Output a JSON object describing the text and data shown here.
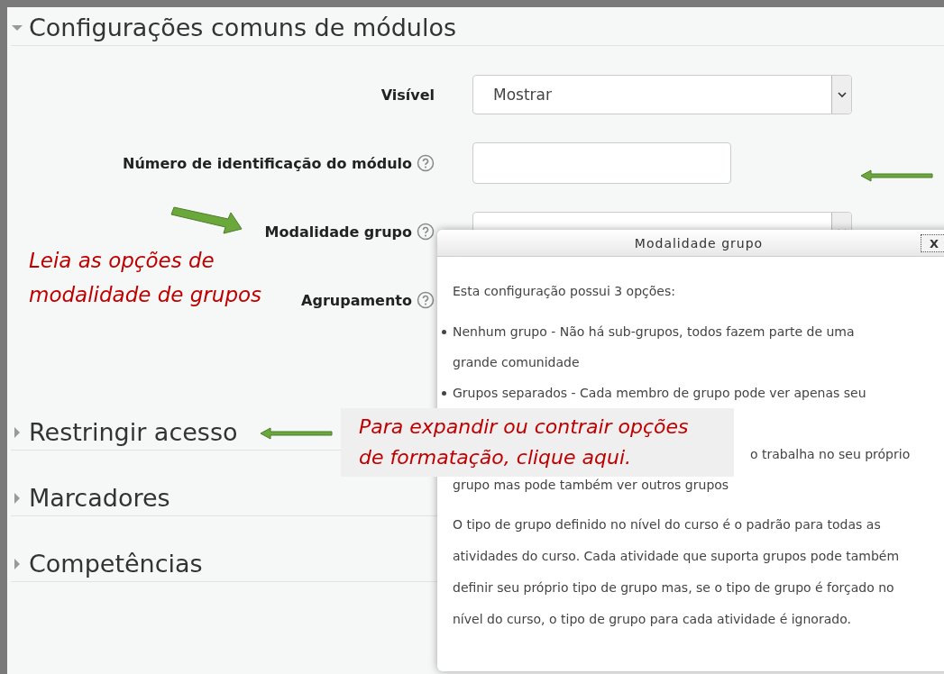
{
  "section": {
    "title": "Configurações comuns de módulos",
    "expanded": true
  },
  "fields": [
    {
      "kind": "select",
      "label": "Visível",
      "value": "Mostrar",
      "help": false
    },
    {
      "kind": "text",
      "label": "Número de identificação do módulo",
      "help": true
    },
    {
      "kind": "select",
      "label": "Modalidade grupo",
      "help": true
    },
    {
      "kind": "none",
      "label": "Agrupamento",
      "help": true
    }
  ],
  "sections": [
    {
      "title": "Restringir acesso",
      "expanded": false
    },
    {
      "title": "Marcadores",
      "expanded": false
    },
    {
      "title": "Competências",
      "expanded": false
    }
  ],
  "popup": {
    "title": "Modalidade grupo",
    "close": "X",
    "intro": "Esta configuração possui 3 opções:",
    "items": [
      {
        "bullet": true,
        "lines": [
          "Nenhum grupo - Não há sub-grupos, todos fazem parte de uma",
          "grande comunidade"
        ]
      },
      {
        "bullet": true,
        "lines": [
          "Grupos separados - Cada membro de grupo pode ver apenas seu"
        ]
      },
      {
        "bullet": false,
        "lines": [
          "o trabalha no seu próprio",
          "grupo mas pode também ver outros grupos"
        ]
      }
    ],
    "footer": "O tipo de grupo definido no nível do curso é o padrão para todas as atividades do curso. Cada atividade que suporta grupos pode também definir seu próprio tipo de grupo mas, se o tipo de grupo é forçado no nível do curso, o tipo de grupo para cada atividade é ignorado."
  },
  "annotations": {
    "read_note": [
      "Leia as opções de",
      "modalidade de grupos"
    ],
    "expand_note": [
      "Para expandir ou contrair opções",
      "de formatação, clique aqui."
    ]
  }
}
